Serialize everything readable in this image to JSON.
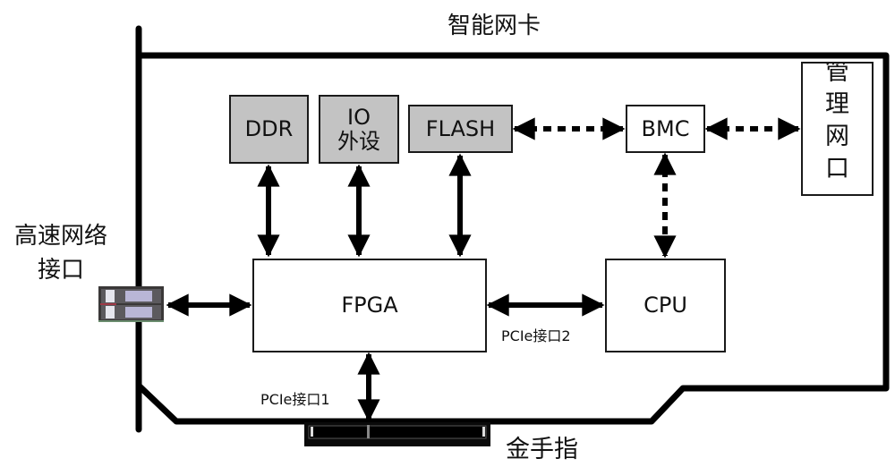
{
  "title": "智能网卡",
  "colors": {
    "line": "#000000",
    "peripheral_fill": "#c3c3c3",
    "block_fill": "#ffffff"
  },
  "labels": {
    "network_port": "高速网络\n接口",
    "network_port_line1": "高速网络",
    "network_port_line2": "接口",
    "gold_finger": "金手指",
    "pcie1": "PCIe接口1",
    "pcie2": "PCIe接口2"
  },
  "blocks": {
    "ddr": "DDR",
    "io_line1": "IO",
    "io_line2": "外设",
    "flash": "FLASH",
    "bmc": "BMC",
    "mgmt_port": [
      "管",
      "理",
      "网",
      "口"
    ],
    "fpga": "FPGA",
    "cpu": "CPU"
  },
  "connections": [
    {
      "from": "DDR",
      "to": "FPGA",
      "style": "solid",
      "bidirectional": true
    },
    {
      "from": "IO外设",
      "to": "FPGA",
      "style": "solid",
      "bidirectional": true
    },
    {
      "from": "FLASH",
      "to": "FPGA",
      "style": "solid",
      "bidirectional": true
    },
    {
      "from": "FLASH",
      "to": "BMC",
      "style": "dashed",
      "bidirectional": true
    },
    {
      "from": "BMC",
      "to": "管理网口",
      "style": "dashed",
      "bidirectional": true
    },
    {
      "from": "BMC",
      "to": "CPU",
      "style": "dashed",
      "bidirectional": true
    },
    {
      "from": "高速网络接口",
      "to": "FPGA",
      "style": "solid",
      "bidirectional": true
    },
    {
      "from": "FPGA",
      "to": "CPU",
      "style": "solid",
      "bidirectional": true,
      "label": "PCIe接口2"
    },
    {
      "from": "FPGA",
      "to": "金手指",
      "style": "solid",
      "bidirectional": true,
      "label": "PCIe接口1"
    }
  ]
}
